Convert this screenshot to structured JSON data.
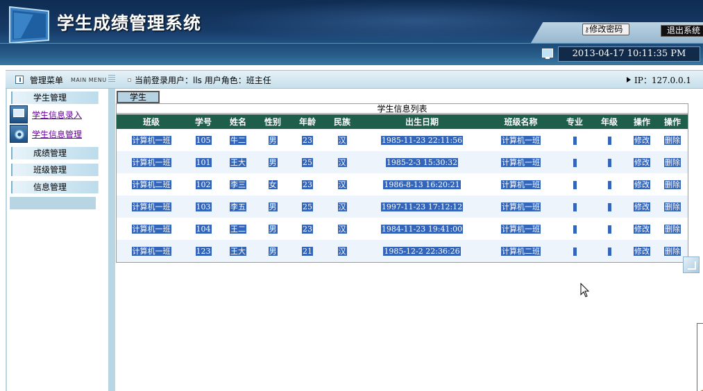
{
  "header": {
    "app_title": "学生成绩管理系统",
    "change_password": "修改密码",
    "exit": "退出系统",
    "datetime": "2013-04-17 10:11:35 PM"
  },
  "status": {
    "menu_label": "管理菜单",
    "menu_sub": "MAIN MENU",
    "user_info": "当前登录用户：lls  用户角色：班主任",
    "ip": "IP：127.0.0.1"
  },
  "sidebar": {
    "student_mgmt": "学生管理",
    "items": [
      "学生信息录入",
      "学生信息管理"
    ],
    "score_mgmt": "成绩管理",
    "class_mgmt": "班级管理",
    "info_mgmt": "信息管理"
  },
  "main": {
    "tab": "学生",
    "table_title": "学生信息列表",
    "columns": [
      "班级",
      "学号",
      "姓名",
      "性别",
      "年龄",
      "民族",
      "出生日期",
      "班级名称",
      "专业",
      "年级",
      "操作",
      "操作"
    ],
    "edit_label": "修改",
    "delete_label": "删除",
    "rows": [
      {
        "class": "计算机一班",
        "id": "105",
        "name": "牛二",
        "gender": "男",
        "age": "23",
        "ethnic": "汉",
        "birth": "1985-11-23 22:11:56",
        "class_name": "计算机一班"
      },
      {
        "class": "计算机一班",
        "id": "101",
        "name": "王大",
        "gender": "男",
        "age": "25",
        "ethnic": "汉",
        "birth": "1985-2-3 15:30:32",
        "class_name": "计算机一班"
      },
      {
        "class": "计算机二班",
        "id": "102",
        "name": "李三",
        "gender": "女",
        "age": "23",
        "ethnic": "汉",
        "birth": "1986-8-13 16:20:21",
        "class_name": "计算机一班"
      },
      {
        "class": "计算机一班",
        "id": "103",
        "name": "李五",
        "gender": "男",
        "age": "25",
        "ethnic": "汉",
        "birth": "1997-11-23 17:12:12",
        "class_name": "计算机一班"
      },
      {
        "class": "计算机一班",
        "id": "104",
        "name": "王二",
        "gender": "男",
        "age": "23",
        "ethnic": "汉",
        "birth": "1984-11-23 19:41:00",
        "class_name": "计算机一班"
      },
      {
        "class": "计算机一班",
        "id": "123",
        "name": "王大",
        "gender": "男",
        "age": "21",
        "ethnic": "汉",
        "birth": "1985-12-2 22:36:26",
        "class_name": "计算机二班"
      }
    ]
  },
  "colors": {
    "header_dark": "#0f2c52",
    "table_header": "#1f5e4b",
    "highlight": "#3366bb",
    "visited_link": "#660099"
  }
}
